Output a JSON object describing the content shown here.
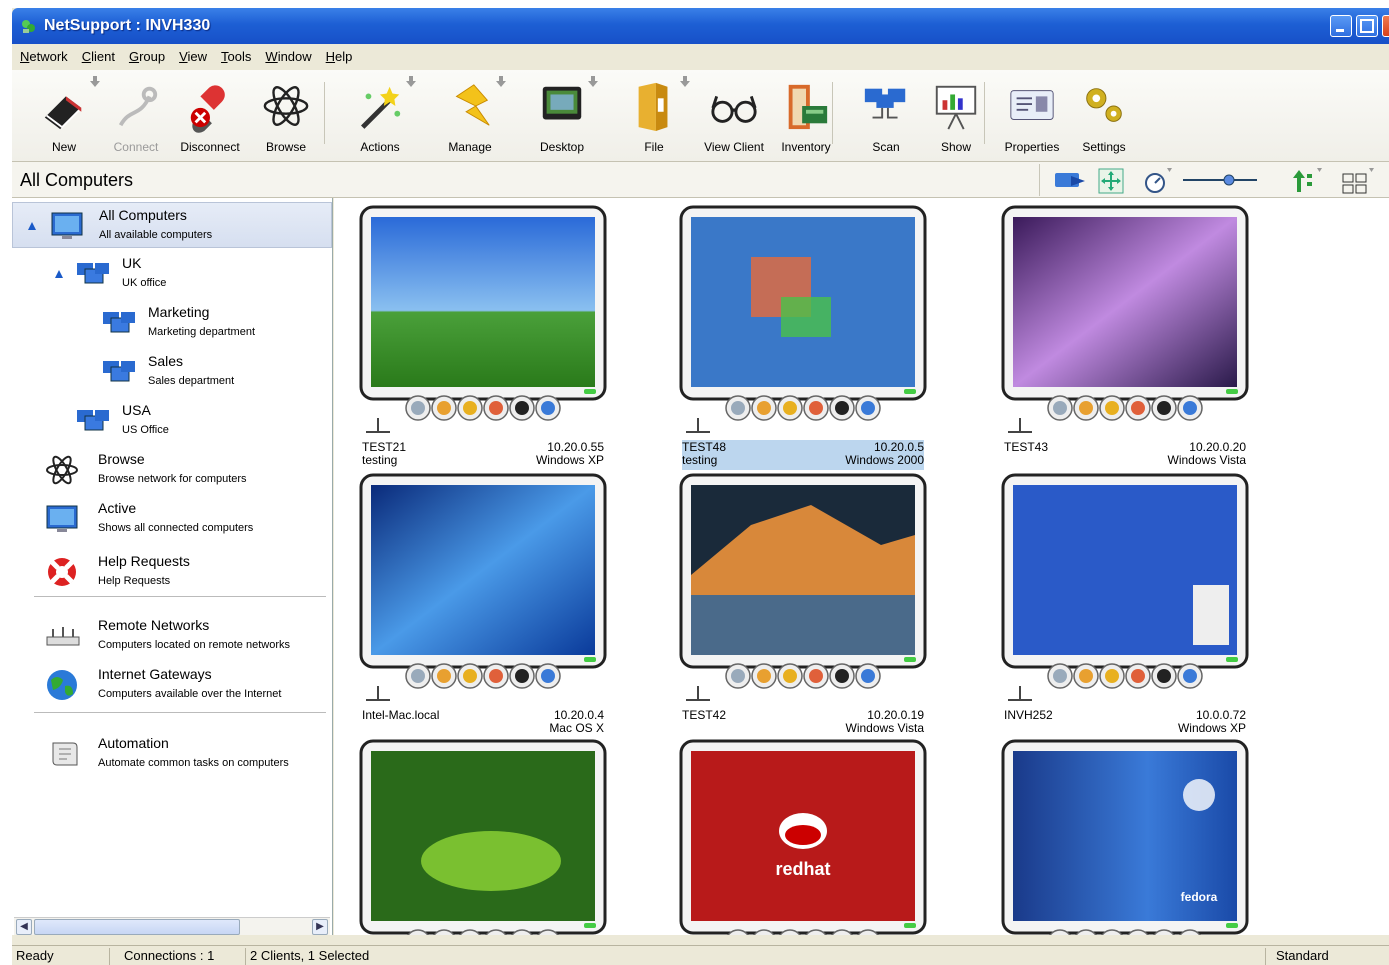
{
  "window": {
    "title": "NetSupport : INVH330"
  },
  "menu": [
    "Network",
    "Client",
    "Group",
    "View",
    "Tools",
    "Window",
    "Help"
  ],
  "toolbar": [
    {
      "label": "New",
      "icon": "new-book-icon"
    },
    {
      "label": "Connect",
      "icon": "connect-plug-icon",
      "disabled": true
    },
    {
      "label": "Disconnect",
      "icon": "disconnect-plug-icon"
    },
    {
      "label": "Browse",
      "icon": "atom-browse-icon"
    },
    {
      "label": "Actions",
      "icon": "magic-wand-icon"
    },
    {
      "label": "Manage",
      "icon": "lightning-icon"
    },
    {
      "label": "Desktop",
      "icon": "desktop-monitor-icon"
    },
    {
      "label": "File",
      "icon": "file-folder-icon"
    },
    {
      "label": "View Client",
      "icon": "glasses-icon"
    },
    {
      "label": "Inventory",
      "icon": "inventory-icon"
    },
    {
      "label": "Scan",
      "icon": "scan-monitors-icon"
    },
    {
      "label": "Show",
      "icon": "show-presentation-icon"
    },
    {
      "label": "Properties",
      "icon": "properties-card-icon"
    },
    {
      "label": "Settings",
      "icon": "settings-gears-icon"
    }
  ],
  "header": {
    "title": "All Computers"
  },
  "sidebar": {
    "items": [
      {
        "name": "All Computers",
        "desc": "All available computers"
      },
      {
        "name": "UK",
        "desc": "UK office"
      },
      {
        "name": "Marketing",
        "desc": "Marketing department"
      },
      {
        "name": "Sales",
        "desc": "Sales department"
      },
      {
        "name": "USA",
        "desc": "US Office"
      },
      {
        "name": "Browse",
        "desc": "Browse network for computers"
      },
      {
        "name": "Active",
        "desc": "Shows all connected computers"
      },
      {
        "name": "Help Requests",
        "desc": "Help Requests"
      },
      {
        "name": "Remote Networks",
        "desc": "Computers located on remote networks"
      },
      {
        "name": "Internet Gateways",
        "desc": "Computers available over the Internet"
      },
      {
        "name": "Automation",
        "desc": "Automate common tasks on computers"
      }
    ]
  },
  "clients": [
    {
      "name": "TEST21",
      "desc": "testing",
      "ip": "10.20.0.55",
      "os": "Windows XP",
      "screen": "xp-bliss",
      "selected": false
    },
    {
      "name": "TEST48",
      "desc": "testing",
      "ip": "10.20.0.5",
      "os": "Windows 2000",
      "screen": "win2000",
      "selected": true
    },
    {
      "name": "TEST43",
      "desc": "",
      "ip": "10.20.0.20",
      "os": "Windows Vista",
      "screen": "vista-purple",
      "selected": false
    },
    {
      "name": "Intel-Mac.local",
      "desc": "",
      "ip": "10.20.0.4",
      "os": "Mac OS X",
      "screen": "mac-blue",
      "selected": false
    },
    {
      "name": "TEST42",
      "desc": "",
      "ip": "10.20.0.19",
      "os": "Windows Vista",
      "screen": "mountain",
      "selected": false
    },
    {
      "name": "INVH252",
      "desc": "",
      "ip": "10.0.0.72",
      "os": "Windows XP",
      "screen": "xp-icons",
      "selected": false
    },
    {
      "name": "",
      "desc": "",
      "ip": "",
      "os": "",
      "screen": "chameleon",
      "selected": false
    },
    {
      "name": "",
      "desc": "",
      "ip": "",
      "os": "",
      "screen": "redhat",
      "selected": false,
      "screen_text": "redhat"
    },
    {
      "name": "",
      "desc": "",
      "ip": "",
      "os": "",
      "screen": "fedora",
      "selected": false,
      "screen_text": "fedora"
    }
  ],
  "status": {
    "ready": "Ready",
    "connections": "Connections : 1",
    "clients": "2 Clients, 1 Selected",
    "mode": "Standard"
  },
  "colors": {
    "titlebar": "#1d5fd4",
    "selection": "#bcd6ee",
    "sidebar_selection": "#d6dff0"
  }
}
